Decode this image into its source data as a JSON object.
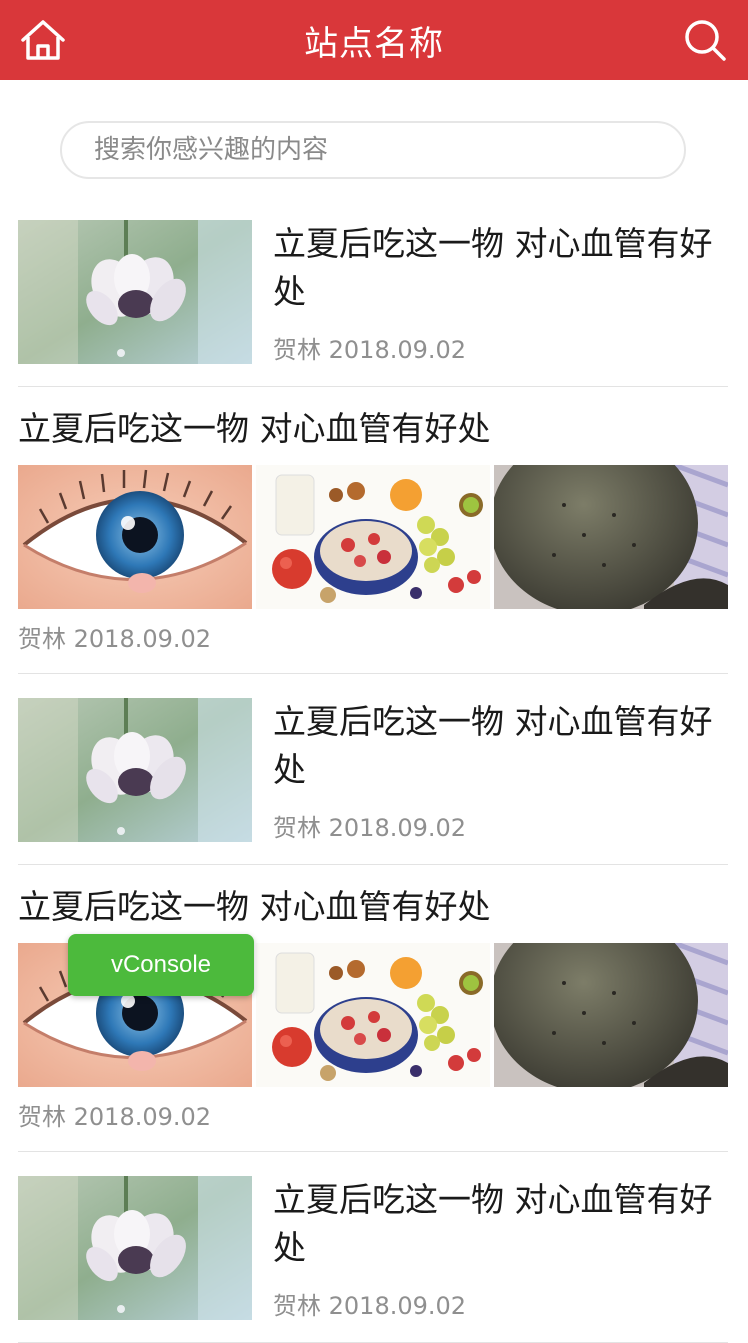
{
  "header": {
    "title": "站点名称",
    "left_icon": "home-icon",
    "right_icon": "search-icon",
    "bg_color": "#d9373a"
  },
  "search": {
    "placeholder": "搜索你感兴趣的内容"
  },
  "articles": [
    {
      "type": "single",
      "title": "立夏后吃这一物 对心血管有好处",
      "author": "贺林",
      "date": "2018.09.02",
      "images": [
        "flower-photo"
      ]
    },
    {
      "type": "multi",
      "title": "立夏后吃这一物 对心血管有好处",
      "author": "贺林",
      "date": "2018.09.02",
      "images": [
        "eye-illustration",
        "fruit-bowl-photo",
        "scalp-photo"
      ]
    },
    {
      "type": "single",
      "title": "立夏后吃这一物 对心血管有好处",
      "author": "贺林",
      "date": "2018.09.02",
      "images": [
        "flower-photo"
      ]
    },
    {
      "type": "multi",
      "title": "立夏后吃这一物 对心血管有好处",
      "author": "贺林",
      "date": "2018.09.02",
      "images": [
        "eye-illustration",
        "fruit-bowl-photo",
        "scalp-photo"
      ]
    },
    {
      "type": "single",
      "title": "立夏后吃这一物 对心血管有好处",
      "author": "贺林",
      "date": "2018.09.02",
      "images": [
        "flower-photo"
      ]
    }
  ],
  "vconsole": {
    "label": "vConsole",
    "color": "#4cba3c"
  }
}
